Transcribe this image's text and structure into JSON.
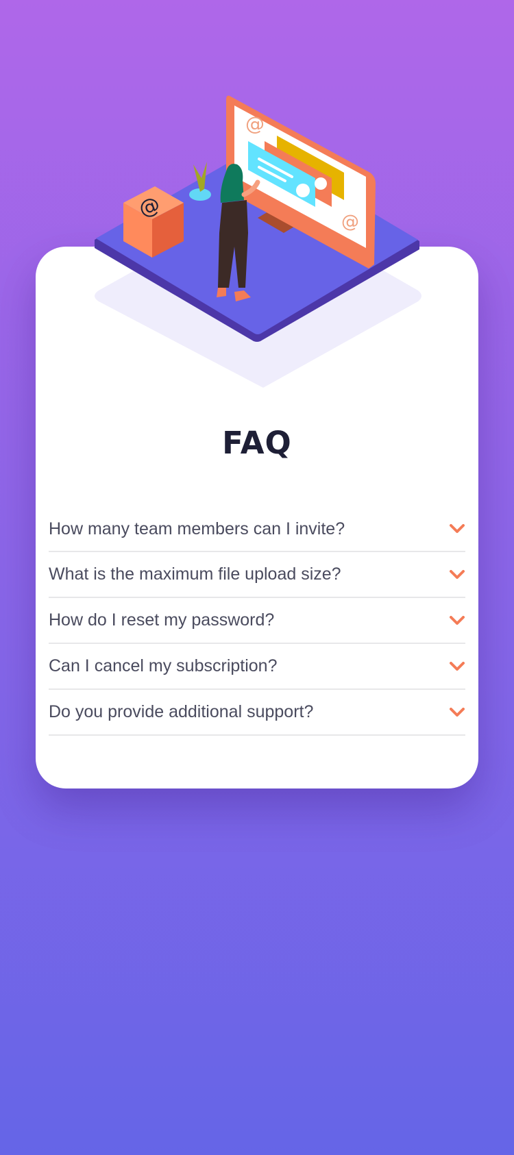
{
  "title": "FAQ",
  "faq": [
    {
      "question": "How many team members can I invite?"
    },
    {
      "question": "What is the maximum file upload size?"
    },
    {
      "question": "How do I reset my password?"
    },
    {
      "question": "Can I cancel my subscription?"
    },
    {
      "question": "Do you provide additional support?"
    }
  ],
  "colors": {
    "background_top": "#af67e9",
    "background_bottom": "#6565e7",
    "card": "#ffffff",
    "title": "#1e1f36",
    "question_text": "#4a4b5e",
    "divider": "#e7e7e9",
    "accent": "#f47c57"
  },
  "icons": {
    "expand": "chevron-down-icon"
  }
}
